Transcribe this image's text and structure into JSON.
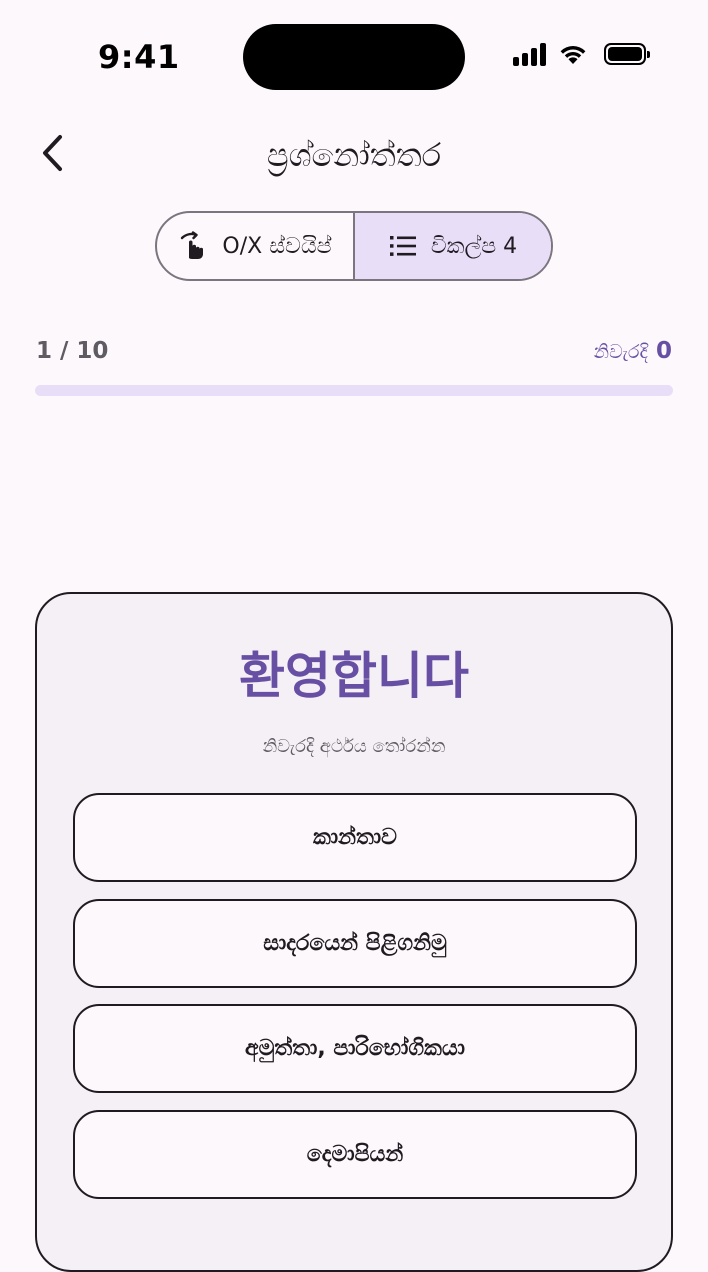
{
  "status_bar": {
    "time": "9:41"
  },
  "header": {
    "title": "ප්‍රශ්නෝත්තර",
    "back_icon": "chevron-left-icon"
  },
  "mode_switch": {
    "swipe_label": "O/X ස්වයිප්",
    "swipe_icon": "swipe-gesture-icon",
    "choice_label": "විකල්ප 4",
    "choice_icon": "list-icon",
    "selected": "choice"
  },
  "progress": {
    "count": "1 / 10",
    "score_label": "නිවැරදි",
    "score_value": "0",
    "fraction": 0.0
  },
  "question": {
    "word": "환영합니다",
    "hint": "නිවැරදි අර්ථය තෝරන්න",
    "options": [
      "කාන්තාව",
      "සාදරයෙන් පිළිගනිමු",
      "අමුත්තා, පාරිභෝගිකයා",
      "දෙමාපියන්"
    ]
  },
  "colors": {
    "accent": "#6750a4",
    "accent_container": "#e8def8",
    "background": "#fdf8fc",
    "card": "#f5f0f6"
  }
}
